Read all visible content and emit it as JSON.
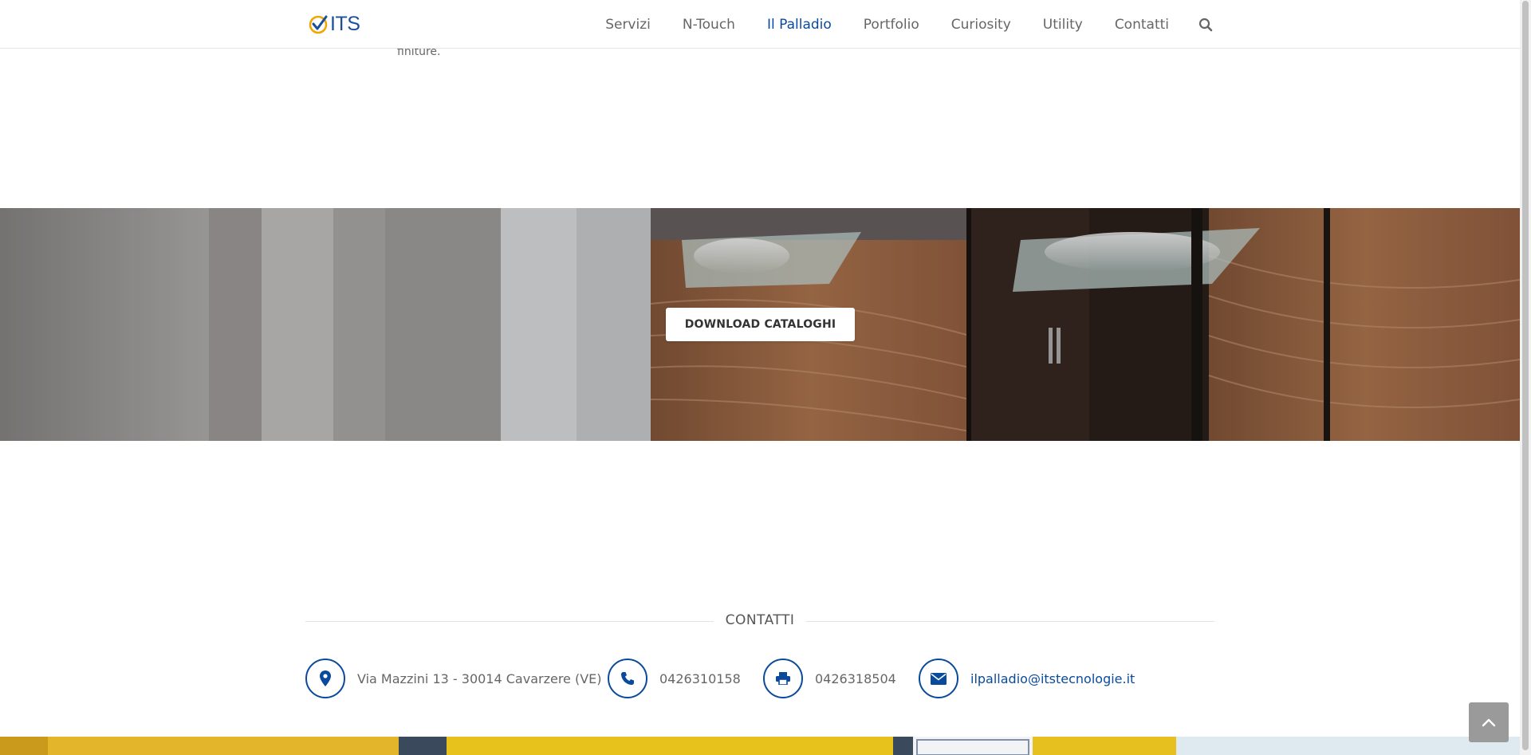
{
  "header": {
    "logo_text": "ITS",
    "nav": [
      {
        "label": "Servizi",
        "active": false
      },
      {
        "label": "N-Touch",
        "active": false
      },
      {
        "label": "Il Palladio",
        "active": true
      },
      {
        "label": "Portfolio",
        "active": false
      },
      {
        "label": "Curiosity",
        "active": false
      },
      {
        "label": "Utility",
        "active": false
      },
      {
        "label": "Contatti",
        "active": false
      }
    ],
    "search_icon": "search-icon"
  },
  "intro": {
    "stray_text": "finiture."
  },
  "banner": {
    "button_label": "DOWNLOAD CATALOGHI"
  },
  "contacts": {
    "title": "CONTATTI",
    "items": [
      {
        "icon": "map-pin-icon",
        "text": "Via Mazzini 13 - 30014 Cavarzere (VE)",
        "link": false
      },
      {
        "icon": "phone-icon",
        "text": "0426310158",
        "link": false
      },
      {
        "icon": "printer-icon",
        "text": "0426318504",
        "link": false
      },
      {
        "icon": "envelope-icon",
        "text": "ilpalladio@itstecnologie.it",
        "link": true
      }
    ]
  },
  "colors": {
    "accent": "#0a4a9c",
    "logo_check": "#f2a400"
  }
}
